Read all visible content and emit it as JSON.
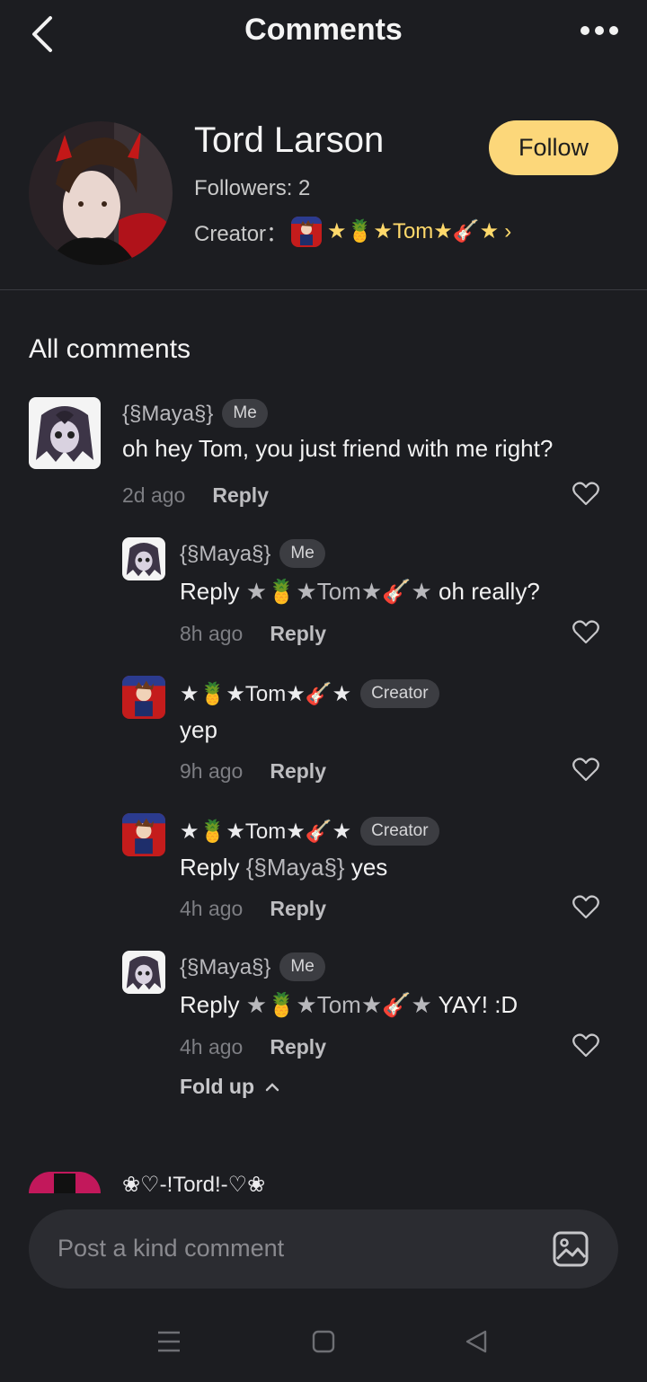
{
  "header": {
    "title": "Comments",
    "back_icon": "chevron-left-icon",
    "more_icon": "more-horizontal-icon"
  },
  "profile": {
    "name": "Tord Larson",
    "followers": "Followers: 2",
    "creator_label": "Creator：",
    "creator_name": "★🍍★Tom★🎸★",
    "follow_label": "Follow",
    "accent_color": "#fcd77a"
  },
  "comments_section": {
    "title": "All comments"
  },
  "comments": {
    "c1": {
      "user": "{§Maya§}",
      "badge": "Me",
      "text": "oh hey Tom, you just friend with me right?",
      "time": "2d ago",
      "reply_label": "Reply"
    },
    "r1": {
      "user": "{§Maya§}",
      "badge": "Me",
      "reply_prefix": "Reply",
      "mention": "★🍍★Tom★🎸★",
      "text": " oh really?",
      "time": "8h ago",
      "reply_label": "Reply"
    },
    "r2": {
      "user": "★🍍★Tom★🎸★",
      "badge": "Creator",
      "text": "yep",
      "time": "9h ago",
      "reply_label": "Reply"
    },
    "r3": {
      "user": "★🍍★Tom★🎸★",
      "badge": "Creator",
      "reply_prefix": "Reply",
      "mention": "{§Maya§}",
      "text": " yes",
      "time": "4h ago",
      "reply_label": "Reply"
    },
    "r4": {
      "user": "{§Maya§}",
      "badge": "Me",
      "reply_prefix": "Reply",
      "mention": "★🍍★Tom★🎸★",
      "text": " YAY! :D",
      "time": "4h ago",
      "reply_label": "Reply"
    },
    "fold_label": "Fold up",
    "next_user": "❀♡-!Tord!-♡❀"
  },
  "composer": {
    "placeholder": "Post a kind comment",
    "image_icon": "image-icon"
  },
  "nav": {
    "menu_icon": "menu-icon",
    "home_icon": "square-icon",
    "back_icon": "triangle-back-icon"
  }
}
